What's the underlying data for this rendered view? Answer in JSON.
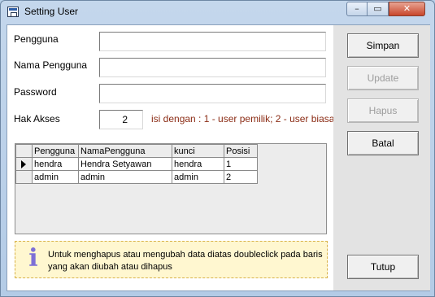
{
  "window": {
    "title": "Setting User",
    "minimize_glyph": "–",
    "maximize_glyph": "▭",
    "close_glyph": "✕"
  },
  "form": {
    "pengguna_label": "Pengguna",
    "pengguna_value": "",
    "nama_pengguna_label": "Nama Pengguna",
    "nama_pengguna_value": "",
    "password_label": "Password",
    "password_value": "",
    "hak_akses_label": "Hak Akses",
    "hak_akses_value": "2",
    "hak_akses_hint": "isi dengan : 1 - user pemilik; 2 - user biasa"
  },
  "buttons": {
    "simpan": "Simpan",
    "update": "Update",
    "hapus": "Hapus",
    "batal": "Batal",
    "tutup": "Tutup"
  },
  "grid": {
    "columns": [
      "Pengguna",
      "NamaPengguna",
      "kunci",
      "Posisi"
    ],
    "rows": [
      {
        "pengguna": "hendra",
        "nama": "Hendra Setyawan",
        "kunci": "hendra",
        "posisi": "1"
      },
      {
        "pengguna": "admin",
        "nama": "admin",
        "kunci": "admin",
        "posisi": "2"
      }
    ]
  },
  "info": {
    "icon": "info-icon",
    "text": "Untuk menghapus atau mengubah data diatas doubleclick pada baris yang akan diubah atau dihapus"
  },
  "colors": {
    "hint": "#8b2c15",
    "info_bg": "#fff7d0",
    "info_icon": "#7d6fd6",
    "panel": "#e3e3e3"
  }
}
